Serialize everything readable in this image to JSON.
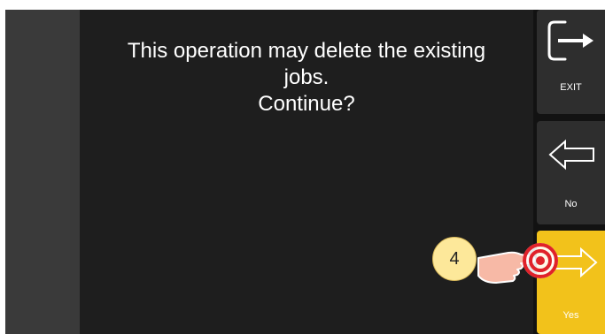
{
  "dialog": {
    "message_line1": "This operation may delete the existing",
    "message_line2": "jobs.",
    "message_line3": "Continue?"
  },
  "sidebar": {
    "exit_label": "EXIT",
    "no_label": "No",
    "yes_label": "Yes"
  },
  "annotation": {
    "step_number": "4"
  },
  "colors": {
    "background": "#1e1e1e",
    "yes_button": "#f2c21b",
    "side_button": "#2e2e2e",
    "badge": "#fde89a",
    "touch_target": "#e0222a"
  }
}
